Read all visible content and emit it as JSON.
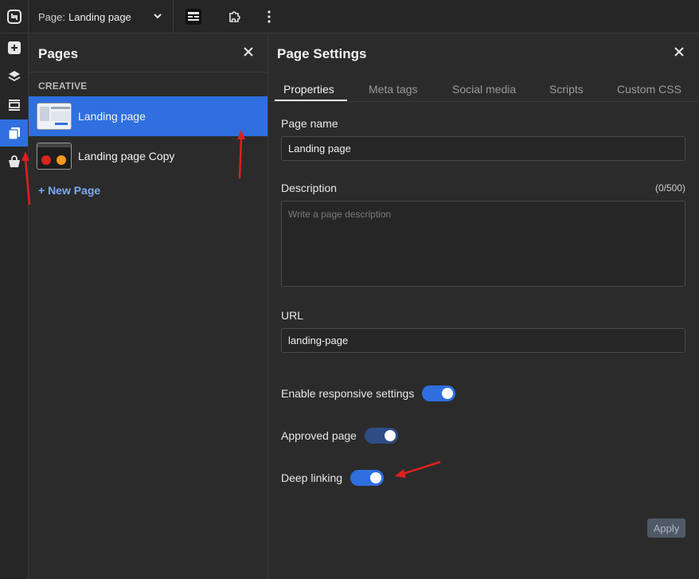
{
  "topbar": {
    "page_label": "Page:",
    "page_value": "Landing page"
  },
  "pages_panel": {
    "title": "Pages",
    "group": "CREATIVE",
    "items": [
      {
        "name": "Landing page",
        "active": true
      },
      {
        "name": "Landing page Copy",
        "active": false
      }
    ],
    "new_page": "+ New Page"
  },
  "settings": {
    "title": "Page Settings",
    "tabs": [
      "Properties",
      "Meta tags",
      "Social media",
      "Scripts",
      "Custom CSS"
    ],
    "active_tab": "Properties",
    "page_name": {
      "label": "Page name",
      "value": "Landing page"
    },
    "description": {
      "label": "Description",
      "counter": "(0/500)",
      "placeholder": "Write a page description"
    },
    "url": {
      "label": "URL",
      "value": "landing-page"
    },
    "toggles": [
      {
        "label": "Enable responsive settings",
        "on": true
      },
      {
        "label": "Approved page",
        "on": true
      },
      {
        "label": "Deep linking",
        "on": true
      }
    ],
    "apply_label": "Apply"
  },
  "colors": {
    "accent": "#2f6fe0",
    "background": "#2b2b2b",
    "link": "#7fa9f5",
    "annotation": "#e01f1f"
  },
  "icons": [
    "app-logo-icon",
    "chevron-down-icon",
    "layout-icon",
    "puzzle-icon",
    "more-vertical-icon",
    "add-icon",
    "layers-icon",
    "sections-icon",
    "pages-icon",
    "store-bag-icon",
    "close-icon"
  ]
}
